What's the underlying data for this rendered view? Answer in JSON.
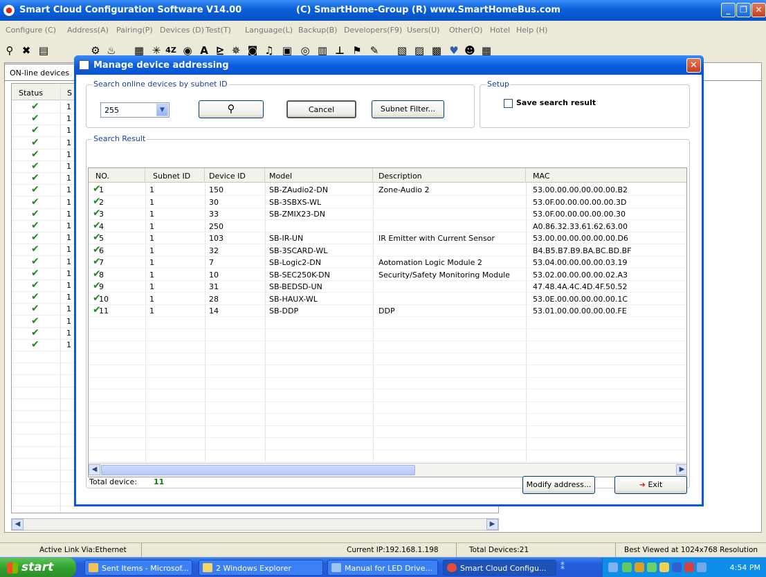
{
  "app": {
    "title": "Smart Cloud Configuration Software V14.00",
    "title_center": "(C) SmartHome-Group (R)  www.SmartHomeBus.com",
    "window_buttons": [
      "minimize",
      "maximize",
      "close"
    ]
  },
  "menu": [
    "Configure (C)",
    "Address(A)",
    "Pairing(P)",
    "Devices (D)",
    "Test(T)",
    "Language(L)",
    "Backup(B)",
    "Developers(F9)",
    "Users(U)",
    "Other(O)",
    "Hotel",
    "Help (H)"
  ],
  "toolbar_icons": [
    "search-icon",
    "delete-icon",
    "document-icon",
    "device-icon",
    "bell-icon",
    "grid-icon",
    "asterisk-icon",
    "counter-icon",
    "globe-icon",
    "text-icon",
    "chart-icon",
    "sparkle-icon",
    "monitor-icon",
    "music-icon",
    "screen-icon",
    "target-icon",
    "layout-icon",
    "tool-icon",
    "flag-icon",
    "paint-icon",
    "calc-icon",
    "table-icon",
    "bars-icon",
    "heart-icon",
    "users-icon",
    "board-icon"
  ],
  "background": {
    "tab_label": "ON-line devices",
    "status_header": "Status",
    "second_header": "S",
    "row_values": [
      "1",
      "1",
      "1",
      "1",
      "1",
      "1",
      "1",
      "1",
      "1",
      "1",
      "1",
      "1",
      "1",
      "1",
      "1",
      "1",
      "1",
      "1",
      "1",
      "1",
      "1"
    ]
  },
  "dialog": {
    "title": "Manage device addressing",
    "search_group_label": "Search online devices by subnet ID",
    "subnet_value": "255",
    "search_button_icon": "magnifier-icon",
    "cancel_label": "Cancel",
    "subnet_filter_label": "Subnet Filter...",
    "setup_group_label": "Setup",
    "save_search_label": "Save search result",
    "save_search_checked": false,
    "result_group_label": "Search Result",
    "columns": [
      "NO.",
      "Subnet ID",
      "Device ID",
      "Model",
      "Description",
      "MAC"
    ],
    "rows": [
      {
        "no": "1",
        "subnet": "1",
        "device": "150",
        "model": "SB-ZAudio2-DN",
        "desc": "Zone-Audio 2",
        "mac": "53.00.00.00.00.00.00.B2"
      },
      {
        "no": "2",
        "subnet": "1",
        "device": "30",
        "model": "SB-3SBXS-WL",
        "desc": "",
        "mac": "53.0F.00.00.00.00.00.3D"
      },
      {
        "no": "3",
        "subnet": "1",
        "device": "33",
        "model": "SB-ZMIX23-DN",
        "desc": "",
        "mac": "53.0F.00.00.00.00.00.30"
      },
      {
        "no": "4",
        "subnet": "1",
        "device": "250",
        "model": "",
        "desc": "",
        "mac": "A0.86.32.33.61.62.63.00"
      },
      {
        "no": "5",
        "subnet": "1",
        "device": "103",
        "model": "SB-IR-UN",
        "desc": "IR Emitter with Current Sensor",
        "mac": "53.00.00.00.00.00.00.D6"
      },
      {
        "no": "6",
        "subnet": "1",
        "device": "32",
        "model": "SB-3SCARD-WL",
        "desc": "",
        "mac": "B4.B5.B7.B9.BA.BC.BD.BF"
      },
      {
        "no": "7",
        "subnet": "1",
        "device": "7",
        "model": "SB-Logic2-DN",
        "desc": "Aotomation Logic Module 2",
        "mac": "53.04.00.00.00.00.03.19"
      },
      {
        "no": "8",
        "subnet": "1",
        "device": "10",
        "model": "SB-SEC250K-DN",
        "desc": "Security/Safety Monitoring Module",
        "mac": "53.02.00.00.00.00.02.A3"
      },
      {
        "no": "9",
        "subnet": "1",
        "device": "31",
        "model": "SB-BEDSD-UN",
        "desc": "",
        "mac": "47.48.4A.4C.4D.4F.50.52"
      },
      {
        "no": "10",
        "subnet": "1",
        "device": "28",
        "model": "SB-HAUX-WL",
        "desc": "",
        "mac": "53.0E.00.00.00.00.00.1C"
      },
      {
        "no": "11",
        "subnet": "1",
        "device": "14",
        "model": "SB-DDP",
        "desc": "DDP",
        "mac": "53.01.00.00.00.00.00.FE"
      }
    ],
    "total_label": "Total device:",
    "total_value": "11",
    "modify_label": "Modify address...",
    "exit_label": "Exit"
  },
  "statusbar": {
    "link": "Active Link Via:Ethernet",
    "ip": "Current IP:192.168.1.198",
    "devices": "Total Devices:21",
    "resolution": "Best Viewed at 1024x768 Resolution"
  },
  "taskbar": {
    "start": "start",
    "tasks": [
      "Sent Items - Microsof...",
      "2 Windows Explorer",
      "Manual for LED Drive...",
      "Smart Cloud Configu..."
    ],
    "clock": "4:54 PM"
  },
  "colors": {
    "xp_blue": "#0a5ae0",
    "check_green": "#1b8a1b",
    "total_green": "#127c12"
  }
}
